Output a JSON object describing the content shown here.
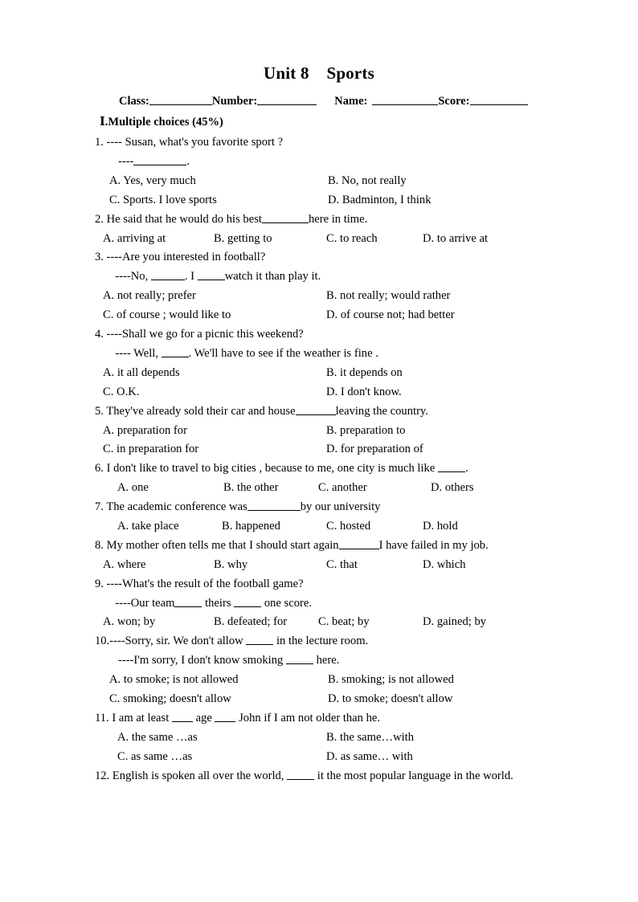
{
  "document": {
    "title": "Unit 8    Sports",
    "header": {
      "class_label": "Class:",
      "number_label": "Number:",
      "name_label": "Name:",
      "score_label": "Score:"
    },
    "section_heading": "Ⅰ.Multiple choices (45%)"
  },
  "questions": [
    {
      "number": "1.",
      "stem": "1. ---- Susan, what's you favorite sport ?",
      "stem2_pre": "   ----",
      "stem2_post": ".",
      "options": {
        "a": "A. Yes, very much",
        "b": "B. No, not really",
        "c": "C. Sports. I love sports",
        "d": "D. Badminton, I think"
      }
    },
    {
      "number": "2.",
      "stem_pre": "2. He said that he would do his best",
      "stem_post": "here in time.",
      "options": {
        "a": "A. arriving at",
        "b": "B. getting to",
        "c": "C. to reach",
        "d": "D. to arrive at"
      }
    },
    {
      "number": "3.",
      "stem": "3. ----Are you interested in football?",
      "stem2_pre": "  ----No, ",
      "stem2_mid": ". I ",
      "stem2_post": "watch it than play it.",
      "options": {
        "a": "A. not really; prefer",
        "b": "B. not really; would rather",
        "c": "C. of course ; would like to",
        "d": "D. of course not; had better"
      }
    },
    {
      "number": "4.",
      "stem": "4. ----Shall we go for a picnic this weekend?",
      "stem2_pre": "  ---- Well, ",
      "stem2_post": ". We'll have to see if the weather is fine .",
      "options": {
        "a": "A. it all depends",
        "b": "B. it depends on",
        "c": "C. O.K.",
        "d": "D. I don't know."
      }
    },
    {
      "number": "5.",
      "stem_pre": "5. They've already sold their car and house",
      "stem_post": "leaving the country.",
      "options": {
        "a": "A. preparation for",
        "b": "B. preparation to",
        "c": "C. in preparation for",
        "d": "D. for preparation of"
      }
    },
    {
      "number": "6.",
      "stem_pre": "6. I don't like to travel to big cities , because to me, one city is much like ",
      "stem_post": ".",
      "options": {
        "a": "A. one",
        "b": "B. the other",
        "c": "C. another",
        "d": "D. others"
      }
    },
    {
      "number": "7.",
      "stem_pre": "7. The academic conference was",
      "stem_post": "by our university",
      "options": {
        "a": "A. take place",
        "b": "B. happened",
        "c": "C. hosted",
        "d": "D. hold"
      }
    },
    {
      "number": "8.",
      "stem_pre": "8. My mother often tells me that I should start again",
      "stem_post": "I have failed in my job.",
      "options": {
        "a": "A. where",
        "b": "B. why",
        "c": "C. that",
        "d": "D. which"
      }
    },
    {
      "number": "9.",
      "stem": "9. ----What's the result of the football game?",
      "stem2_pre": "  ----Our team",
      "stem2_mid": " theirs ",
      "stem2_post": " one score.",
      "options": {
        "a": "A. won; by",
        "b": "B. defeated; for",
        "c": "C. beat; by",
        "d": "D. gained; by"
      }
    },
    {
      "number": "10.",
      "stem_pre": "10.----Sorry, sir. We don't allow ",
      "stem_post": " in the lecture room.",
      "stem2_pre": "   ----I'm sorry, I don't know smoking ",
      "stem2_post": " here.",
      "options": {
        "a": "A. to smoke; is not allowed",
        "b": "B. smoking; is not allowed",
        "c": "C. smoking; doesn't allow",
        "d": "D. to smoke; doesn't allow"
      }
    },
    {
      "number": "11.",
      "stem_pre": "11. I am at least ",
      "stem_mid": " age ",
      "stem_post": " John if I am not older than he.",
      "options": {
        "a": "A. the same …as",
        "b": "B. the same…with",
        "c": "C. as same …as",
        "d": "D. as same… with"
      }
    },
    {
      "number": "12.",
      "stem_pre": "12. English is spoken all over the world, ",
      "stem_post": " it the most popular language in the world."
    }
  ]
}
